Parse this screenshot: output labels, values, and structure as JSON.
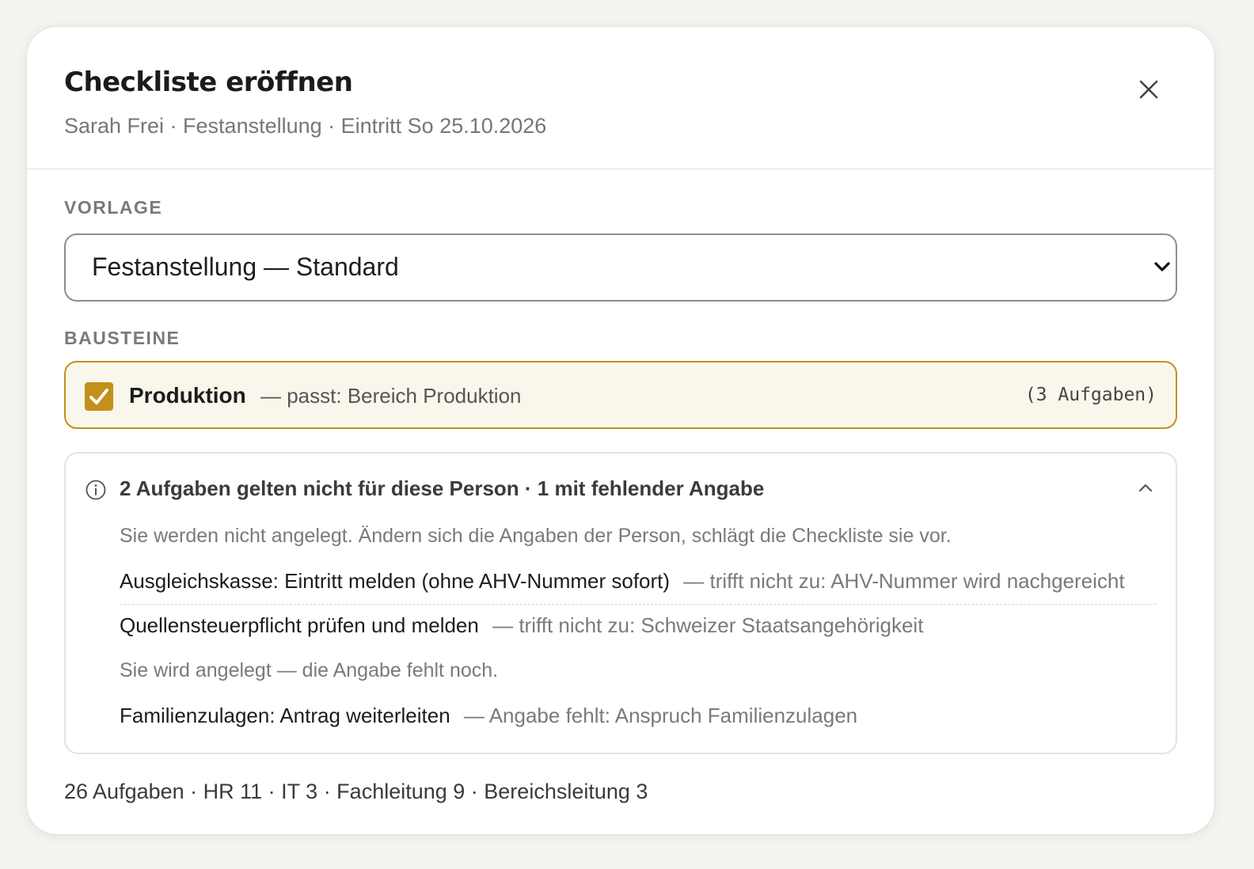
{
  "dialog": {
    "title": "Checkliste eröffnen",
    "subtitle": "Sarah Frei · Festanstellung · Eintritt So 25.10.2026",
    "close_icon": "close-icon"
  },
  "template": {
    "label": "VORLAGE",
    "selected": "Festanstellung — Standard"
  },
  "modules": {
    "label": "BAUSTEINE",
    "items": [
      {
        "checked": true,
        "name": "Produktion",
        "reason": "— passt: Bereich Produktion",
        "count": "(3 Aufgaben)"
      }
    ]
  },
  "excluded": {
    "title": "2 Aufgaben gelten nicht für diese Person · 1 mit fehlender Angabe",
    "note": "Sie werden nicht angelegt. Ändern sich die Angaben der Person, schlägt die Checkliste sie vor.",
    "tasks": [
      {
        "name": "Ausgleichskasse: Eintritt melden (ohne AHV-Nummer sofort)",
        "reason": "— trifft nicht zu: AHV-Nummer wird nachgereicht"
      },
      {
        "name": "Quellensteuerpflicht prüfen und melden",
        "reason": "— trifft nicht zu: Schweizer Staatsangehörigkeit"
      }
    ],
    "missing_note": "Sie wird angelegt — die Angabe fehlt noch.",
    "missing_tasks": [
      {
        "name": "Familienzulagen: Antrag weiterleiten",
        "reason": "— Angabe fehlt: Anspruch Familienzulagen"
      }
    ]
  },
  "summary": "26 Aufgaben · HR 11 · IT 3 · Fachleitung 9 · Bereichsleitung 3",
  "colors": {
    "accent": "#c4901b",
    "accent_bg": "#f9f6ec"
  }
}
